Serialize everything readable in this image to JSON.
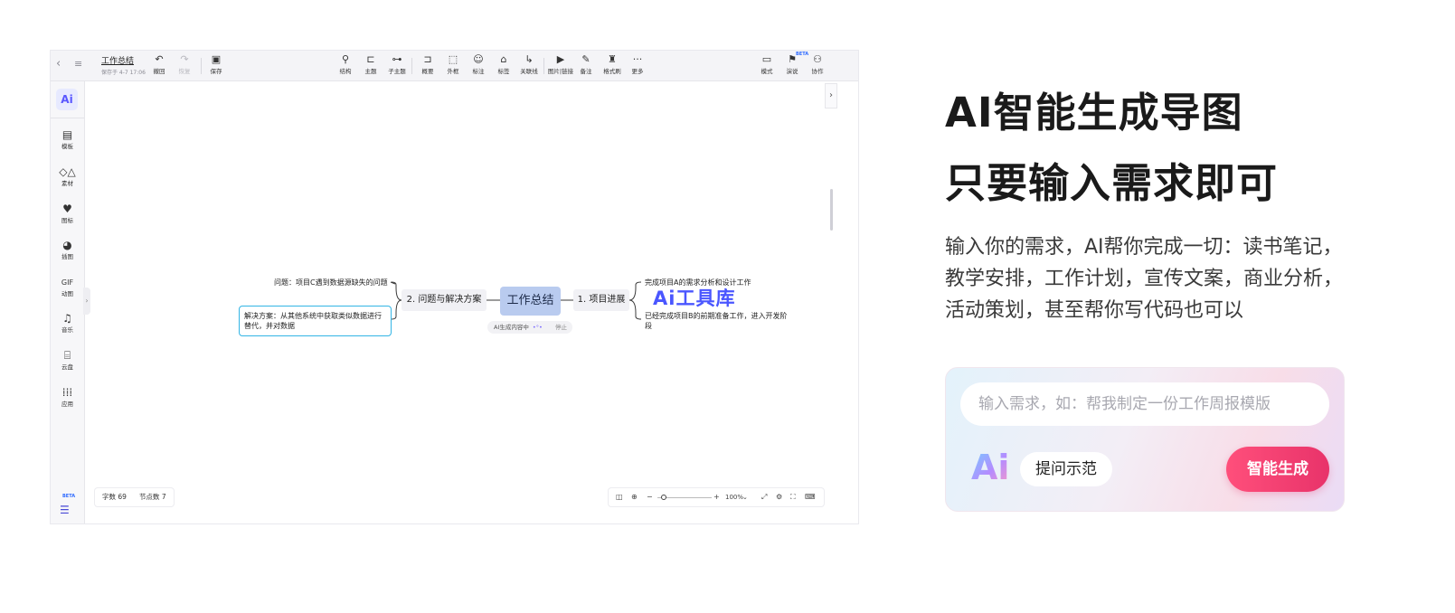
{
  "app": {
    "nav": {
      "back_icon": "chevron-left-icon",
      "menu_icon": "hamburger-icon"
    },
    "doc_title": "工作总结",
    "doc_saved": "保存于 4-7 17:06",
    "toolbar_left": [
      {
        "name": "undo",
        "label": "撤回",
        "icon": "undo-icon"
      },
      {
        "name": "redo",
        "label": "恢复",
        "icon": "redo-icon"
      },
      {
        "name": "save",
        "label": "保存",
        "icon": "save-icon"
      }
    ],
    "toolbar_center": [
      {
        "name": "structure",
        "label": "结构",
        "icon": "structure-icon"
      },
      {
        "name": "topic",
        "label": "主题",
        "icon": "topic-icon"
      },
      {
        "name": "subtopic",
        "label": "子主题",
        "icon": "subtopic-icon"
      },
      {
        "name": "summary",
        "label": "概要",
        "icon": "summary-icon"
      },
      {
        "name": "boundary",
        "label": "外框",
        "icon": "boundary-icon"
      },
      {
        "name": "comment",
        "label": "标注",
        "icon": "comment-icon"
      },
      {
        "name": "tag",
        "label": "标签",
        "icon": "tag-icon"
      },
      {
        "name": "relation",
        "label": "关联线",
        "icon": "relation-line-icon"
      },
      {
        "name": "image-link",
        "label": "图片|链接",
        "icon": "image-icon"
      },
      {
        "name": "note",
        "label": "备注",
        "icon": "note-icon"
      },
      {
        "name": "format-painter",
        "label": "格式刷",
        "icon": "format-painter-icon"
      },
      {
        "name": "more",
        "label": "更多",
        "icon": "more-icon"
      }
    ],
    "toolbar_right": [
      {
        "name": "mode",
        "label": "模式",
        "icon": "mode-icon"
      },
      {
        "name": "present",
        "label": "演说",
        "icon": "present-icon"
      },
      {
        "name": "collab",
        "label": "协作",
        "icon": "collab-icon"
      }
    ],
    "beta_label": "BETA",
    "rail_logo": "Ai",
    "rail_items": [
      {
        "name": "template",
        "label": "模板",
        "icon": "template-icon"
      },
      {
        "name": "material",
        "label": "素材",
        "icon": "shapes-icon"
      },
      {
        "name": "sticker",
        "label": "图标",
        "icon": "heart-icon"
      },
      {
        "name": "illustration",
        "label": "插图",
        "icon": "palette-icon"
      },
      {
        "name": "gif",
        "label": "动图",
        "icon": "gif-icon"
      },
      {
        "name": "music",
        "label": "音乐",
        "icon": "music-icon"
      },
      {
        "name": "cloud",
        "label": "云盘",
        "icon": "cloud-drive-icon"
      },
      {
        "name": "apps",
        "label": "应用",
        "icon": "apps-grid-icon"
      }
    ],
    "rail_beta": "BETA",
    "mindmap": {
      "root": "工作总结",
      "left_branch": "2. 问题与解决方案",
      "left_leaf_1": "问题：项目C遇到数据源缺失的问题",
      "left_leaf_2": "解决方案：从其他系统中获取类似数据进行替代，并对数据",
      "right_branch": "1. 项目进展",
      "right_leaf_1": "完成项目A的需求分析和设计工作",
      "right_leaf_2": "已经完成项目B的前期准备工作，进入开发阶段",
      "generating": "AI生成内容中",
      "generating_dots": "•°•",
      "stop": "停止"
    },
    "watermark": "Ai工具库",
    "stats": {
      "chars": "字数 69",
      "nodes": "节点数 7"
    },
    "zoom": "100%"
  },
  "promo": {
    "headline_1": "AI智能生成导图",
    "headline_2": "只要输入需求即可",
    "description": "输入你的需求，AI帮你完成一切：读书笔记，教学安排，工作计划，宣传文案，商业分析，活动策划，甚至帮你写代码也可以",
    "input_placeholder": "输入需求，如：帮我制定一份工作周报模版",
    "ai_logo": "Ai",
    "example_label": "提问示范",
    "generate_label": "智能生成",
    "colors": {
      "accent": "#e8336a",
      "selection": "#33b5e5",
      "root_node": "#b9cbef"
    }
  }
}
